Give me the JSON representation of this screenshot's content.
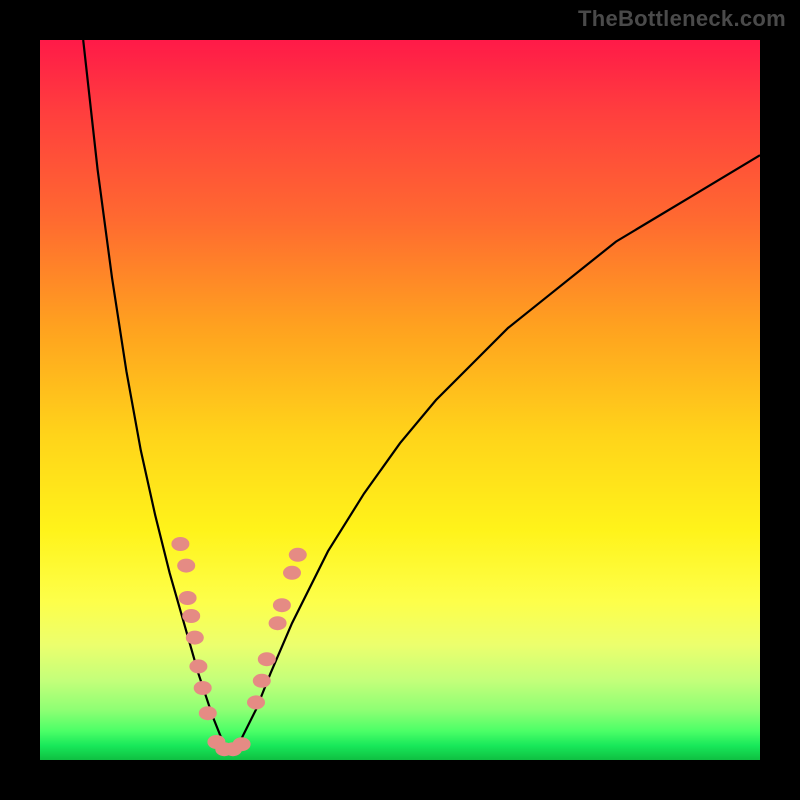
{
  "watermark": "TheBottleneck.com",
  "metrics_label": "",
  "colors": {
    "black": "#000000",
    "bead": "#e58b84",
    "gradient_top": "#ff1a48",
    "gradient_bottom": "#0fbf41"
  },
  "chart_data": {
    "type": "line",
    "title": "",
    "xlabel": "",
    "ylabel": "",
    "xlim": [
      0,
      100
    ],
    "ylim": [
      0,
      100
    ],
    "note": "Bottleneck-style V-curve. Minimum (best match) near x≈26. Left branch rises steeply to 100 at x≈6; right branch rises gradually to ~85 at x=100. No numeric axis labels rendered in source image.",
    "series": [
      {
        "name": "bottleneck_curve",
        "x": [
          6,
          8,
          10,
          12,
          14,
          16,
          18,
          20,
          22,
          24,
          26,
          28,
          30,
          32,
          35,
          40,
          45,
          50,
          55,
          60,
          65,
          70,
          75,
          80,
          85,
          90,
          95,
          100
        ],
        "y": [
          100,
          82,
          67,
          54,
          43,
          34,
          26,
          19,
          12,
          6,
          1,
          3,
          7,
          12,
          19,
          29,
          37,
          44,
          50,
          55,
          60,
          64,
          68,
          72,
          75,
          78,
          81,
          84
        ]
      }
    ],
    "markers": {
      "name": "gpu_models",
      "note": "Salmon beads clustered around the curve minimum; heights are read from vertical position (~% bottleneck).",
      "points": [
        {
          "x": 19.5,
          "y": 30
        },
        {
          "x": 20.3,
          "y": 27
        },
        {
          "x": 20.5,
          "y": 22.5
        },
        {
          "x": 21.0,
          "y": 20
        },
        {
          "x": 21.5,
          "y": 17
        },
        {
          "x": 22.0,
          "y": 13
        },
        {
          "x": 22.6,
          "y": 10
        },
        {
          "x": 23.3,
          "y": 6.5
        },
        {
          "x": 24.5,
          "y": 2.5
        },
        {
          "x": 25.6,
          "y": 1.5
        },
        {
          "x": 26.8,
          "y": 1.5
        },
        {
          "x": 28.0,
          "y": 2.2
        },
        {
          "x": 30.0,
          "y": 8
        },
        {
          "x": 30.8,
          "y": 11
        },
        {
          "x": 31.5,
          "y": 14
        },
        {
          "x": 33.0,
          "y": 19
        },
        {
          "x": 33.6,
          "y": 21.5
        },
        {
          "x": 35.0,
          "y": 26
        },
        {
          "x": 35.8,
          "y": 28.5
        }
      ]
    }
  }
}
